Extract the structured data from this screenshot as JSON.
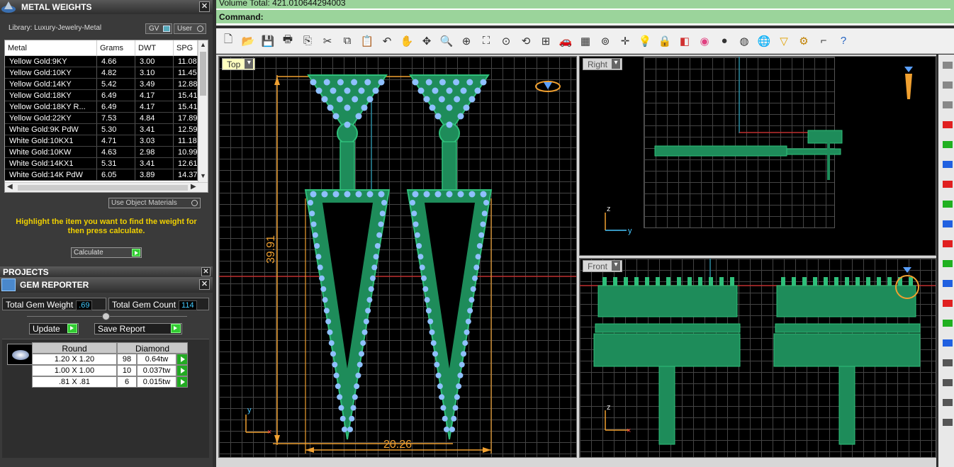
{
  "metal_weights": {
    "title": "METAL WEIGHTS",
    "library": "Library: Luxury-Jewelry-Metal",
    "gv_label": "GV",
    "user_label": "User",
    "columns": [
      "Metal",
      "Grams",
      "DWT",
      "SPG"
    ],
    "rows": [
      {
        "metal": "Yellow Gold:9KY",
        "grams": "4.66",
        "dwt": "3.00",
        "spg": "11.08"
      },
      {
        "metal": "Yellow Gold:10KY",
        "grams": "4.82",
        "dwt": "3.10",
        "spg": "11.45"
      },
      {
        "metal": "Yellow Gold:14KY",
        "grams": "5.42",
        "dwt": "3.49",
        "spg": "12.88"
      },
      {
        "metal": "Yellow Gold:18KY",
        "grams": "6.49",
        "dwt": "4.17",
        "spg": "15.41"
      },
      {
        "metal": "Yellow Gold:18KY R...",
        "grams": "6.49",
        "dwt": "4.17",
        "spg": "15.41"
      },
      {
        "metal": "Yellow Gold:22KY",
        "grams": "7.53",
        "dwt": "4.84",
        "spg": "17.89"
      },
      {
        "metal": "White Gold:9K PdW",
        "grams": "5.30",
        "dwt": "3.41",
        "spg": "12.59"
      },
      {
        "metal": "White Gold:10KX1",
        "grams": "4.71",
        "dwt": "3.03",
        "spg": "11.18"
      },
      {
        "metal": "White Gold:10KW",
        "grams": "4.63",
        "dwt": "2.98",
        "spg": "10.99"
      },
      {
        "metal": "White Gold:14KX1",
        "grams": "5.31",
        "dwt": "3.41",
        "spg": "12.61"
      },
      {
        "metal": "White Gold:14K PdW",
        "grams": "6.05",
        "dwt": "3.89",
        "spg": "14.37"
      }
    ],
    "use_object_materials": "Use Object Materials",
    "hint": "Highlight the item you want to find the weight for then press calculate.",
    "calculate": "Calculate"
  },
  "projects": {
    "title": "PROJECTS"
  },
  "gem_reporter": {
    "title": "GEM REPORTER",
    "total_weight_label": "Total Gem Weight",
    "total_weight_value": ".69",
    "total_count_label": "Total Gem Count",
    "total_count_value": "114",
    "update": "Update",
    "save_report": "Save Report",
    "table_headers": [
      "Round",
      "Diamond"
    ],
    "rows": [
      {
        "size": "1.20 X 1.20",
        "count": "98",
        "weight": "0.64tw"
      },
      {
        "size": "1.00 X 1.00",
        "count": "10",
        "weight": "0.037tw"
      },
      {
        "size": ".81 X .81",
        "count": "6",
        "weight": "0.015tw"
      }
    ]
  },
  "command": {
    "history": "Volume Total: 421.010644294003",
    "prompt": "Command:"
  },
  "toolbar_icons": [
    "new-icon",
    "open-icon",
    "save-icon",
    "print-icon",
    "export-icon",
    "cut-icon",
    "copy-icon",
    "paste-icon",
    "undo-icon",
    "pan-icon",
    "move-icon",
    "zoom-icon",
    "zoom-window-icon",
    "zoom-extents-icon",
    "zoom-selected-icon",
    "rotate-view-icon",
    "four-viewports-icon",
    "car-icon",
    "grid-icon",
    "snap-icon",
    "point-icon",
    "light-icon",
    "lock-icon",
    "layer-icon",
    "color-icon",
    "sphere-icon",
    "render-icon",
    "globe-icon",
    "cone-icon",
    "gear-icon",
    "dimension-icon",
    "help-icon"
  ],
  "viewports": {
    "top": {
      "label": "Top",
      "dim_vertical": "39.91",
      "dim_horizontal": "20.26",
      "axis_y": "y"
    },
    "right": {
      "label": "Right",
      "axis_z": "z",
      "axis_y": "y"
    },
    "front": {
      "label": "Front",
      "axis_z": "z"
    }
  },
  "colors": {
    "metal_green": "#1e8c5a",
    "gem_blue": "#8fc0ff",
    "dimension_orange": "#f0a030",
    "command_green": "#9bd49b"
  }
}
